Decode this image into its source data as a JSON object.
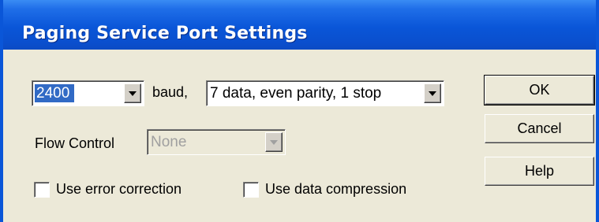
{
  "dialog": {
    "title": "Paging Service Port Settings"
  },
  "baud": {
    "selected": "2400",
    "label": "baud,"
  },
  "data_format": {
    "selected": "7 data, even parity, 1 stop"
  },
  "flow_control": {
    "label": "Flow Control",
    "selected": "None",
    "enabled": false
  },
  "options": {
    "error_correction": {
      "label": "Use error correction",
      "checked": false
    },
    "data_compression": {
      "label": "Use data compression",
      "checked": false
    }
  },
  "buttons": {
    "ok": "OK",
    "cancel": "Cancel",
    "help": "Help"
  },
  "colors": {
    "title_bar": "#0a56d8",
    "dialog_face": "#ece9d8",
    "selection": "#316ac5",
    "disabled_text": "#a0a0a0"
  }
}
